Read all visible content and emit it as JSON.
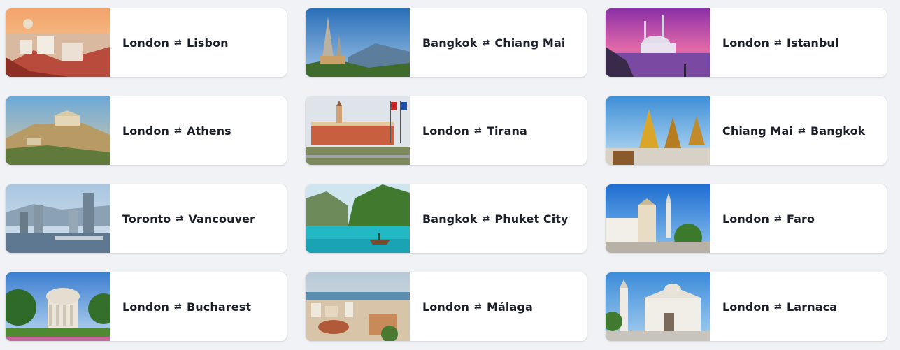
{
  "routes": [
    {
      "from": "London",
      "to": "Lisbon"
    },
    {
      "from": "Bangkok",
      "to": "Chiang Mai"
    },
    {
      "from": "London",
      "to": "Istanbul"
    },
    {
      "from": "London",
      "to": "Athens"
    },
    {
      "from": "London",
      "to": "Tirana"
    },
    {
      "from": "Chiang Mai",
      "to": "Bangkok"
    },
    {
      "from": "Toronto",
      "to": "Vancouver"
    },
    {
      "from": "Bangkok",
      "to": "Phuket City"
    },
    {
      "from": "London",
      "to": "Faro"
    },
    {
      "from": "London",
      "to": "Bucharest"
    },
    {
      "from": "London",
      "to": "Málaga"
    },
    {
      "from": "London",
      "to": "Larnaca"
    }
  ],
  "arrow_symbol": "⇄",
  "icons": {
    "route_arrow": "swap-arrows-icon"
  },
  "colors": {
    "background": "#f0f2f5",
    "card": "#ffffff",
    "text": "#1b1f2a"
  }
}
